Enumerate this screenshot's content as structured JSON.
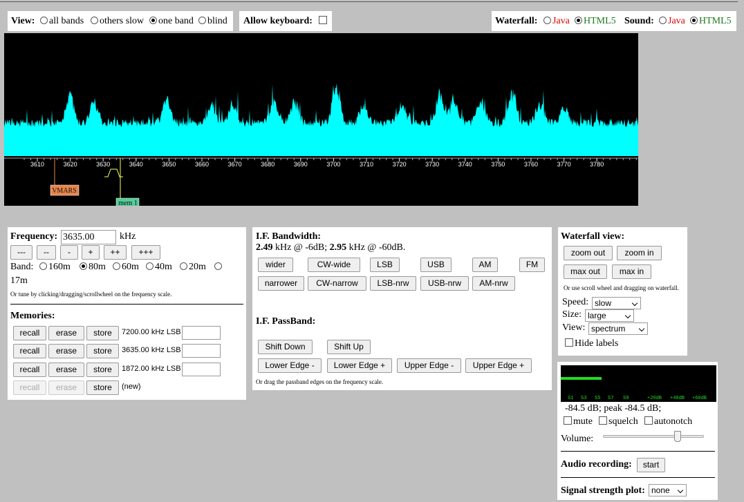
{
  "top_bar": {
    "view_label": "View:",
    "view_options": [
      "all bands",
      "others slow",
      "one band",
      "blind"
    ],
    "keyboard_label": "Allow keyboard:",
    "waterfall_label": "Waterfall:",
    "sound_label": "Sound:",
    "java": "Java",
    "html5": "HTML5"
  },
  "spectrum": {
    "ticks": [
      "3610",
      "3620",
      "3630",
      "3640",
      "3650",
      "3660",
      "3670",
      "3680",
      "3690",
      "3700",
      "3710",
      "3720",
      "3730",
      "3740",
      "3750",
      "3760",
      "3770",
      "3780"
    ],
    "markers": [
      "VMARS",
      "mem 1"
    ],
    "colors": {
      "trace": "#00ffff",
      "background": "#000000",
      "marker_vmars": "#e8864a",
      "marker_mem": "#55cc99"
    }
  },
  "frequency": {
    "label": "Frequency:",
    "value": "3635.00",
    "unit": "kHz",
    "step_buttons": [
      "---",
      "--",
      "-",
      "+",
      "++",
      "+++"
    ],
    "band_label": "Band:",
    "bands": [
      "160m",
      "80m",
      "60m",
      "40m",
      "20m",
      "17m"
    ],
    "hint": "Or tune by clicking/dragging/scrollwheel on the frequency scale."
  },
  "memories": {
    "title": "Memories:",
    "recall": "recall",
    "erase": "erase",
    "store": "store",
    "entries": [
      "7200.00 kHz LSB",
      "3635.00 kHz LSB",
      "1872.00 kHz LSB",
      "(new)"
    ]
  },
  "if_bandwidth": {
    "title": "I.F. Bandwidth:",
    "bw1": "2.49",
    "bw1_text": "kHz @ -6dB;",
    "bw2": "2.95",
    "bw2_text": "kHz @ -60dB.",
    "row1": [
      "wider",
      "CW-wide",
      "LSB",
      "USB",
      "AM",
      "FM"
    ],
    "row2": [
      "narrower",
      "CW-narrow",
      "LSB-nrw",
      "USB-nrw",
      "AM-nrw"
    ]
  },
  "if_passband": {
    "title": "I.F. PassBand:",
    "shift_down": "Shift Down",
    "shift_up": "Shift Up",
    "lower_minus": "Lower Edge -",
    "lower_plus": "Lower Edge +",
    "upper_minus": "Upper Edge -",
    "upper_plus": "Upper Edge +",
    "hint": "Or drag the passband edges on the frequency scale."
  },
  "waterfall_view": {
    "title": "Waterfall view:",
    "zoom_out": "zoom out",
    "zoom_in": "zoom in",
    "max_out": "max out",
    "max_in": "max in",
    "hint": "Or use scroll wheel and dragging on waterfall.",
    "speed_label": "Speed:",
    "speed_value": "slow",
    "size_label": "Size:",
    "size_value": "large",
    "view_label": "View:",
    "view_value": "spectrum",
    "hide_labels": "Hide labels"
  },
  "smeter": {
    "scale": [
      "S1",
      "S3",
      "S5",
      "S7",
      "S9",
      "+20dB",
      "+40dB",
      "+60dB"
    ],
    "level_fraction": 0.26,
    "readout": "-84.5 dB; peak   -84.5 dB;",
    "mute": "mute",
    "squelch": "squelch",
    "autonotch": "autonotch",
    "volume_label": "Volume:",
    "volume_fraction": 0.73,
    "audio_recording": "Audio recording:",
    "start": "start",
    "plot_label": "Signal strength plot:",
    "plot_value": "none"
  }
}
